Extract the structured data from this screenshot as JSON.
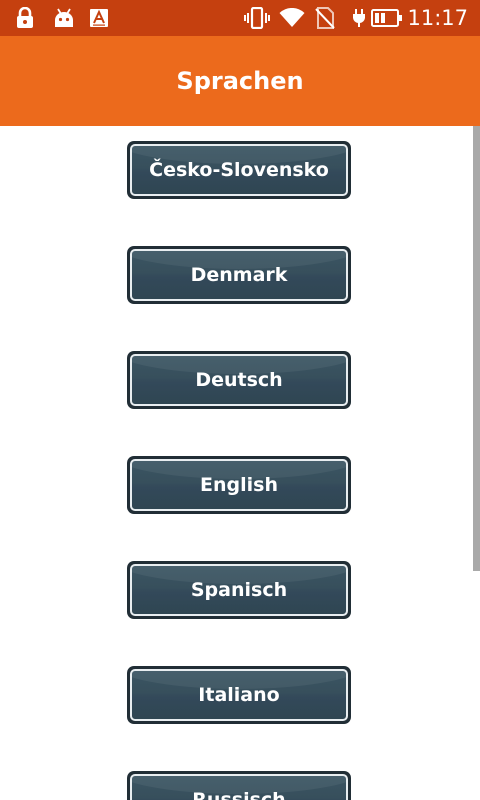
{
  "status_bar": {
    "time": "11:17",
    "background": "#c5400f",
    "icons_left": [
      "lock-icon",
      "android-debug-icon",
      "text-a-icon"
    ],
    "icons_right": [
      "vibrate-icon",
      "wifi-icon",
      "no-sim-icon",
      "charging-icon",
      "battery-icon"
    ]
  },
  "app_bar": {
    "title": "Sprachen",
    "background": "#ec6a1c"
  },
  "languages": [
    {
      "label": "Česko-Slovensko"
    },
    {
      "label": "Denmark"
    },
    {
      "label": "Deutsch"
    },
    {
      "label": "English"
    },
    {
      "label": "Spanisch"
    },
    {
      "label": "Italiano"
    },
    {
      "label": "Russisch"
    }
  ],
  "colors": {
    "button_fill": "#344b58",
    "button_border": "#e8edf0",
    "button_outline": "#212e36",
    "scrollbar": "#a9a9a9"
  }
}
